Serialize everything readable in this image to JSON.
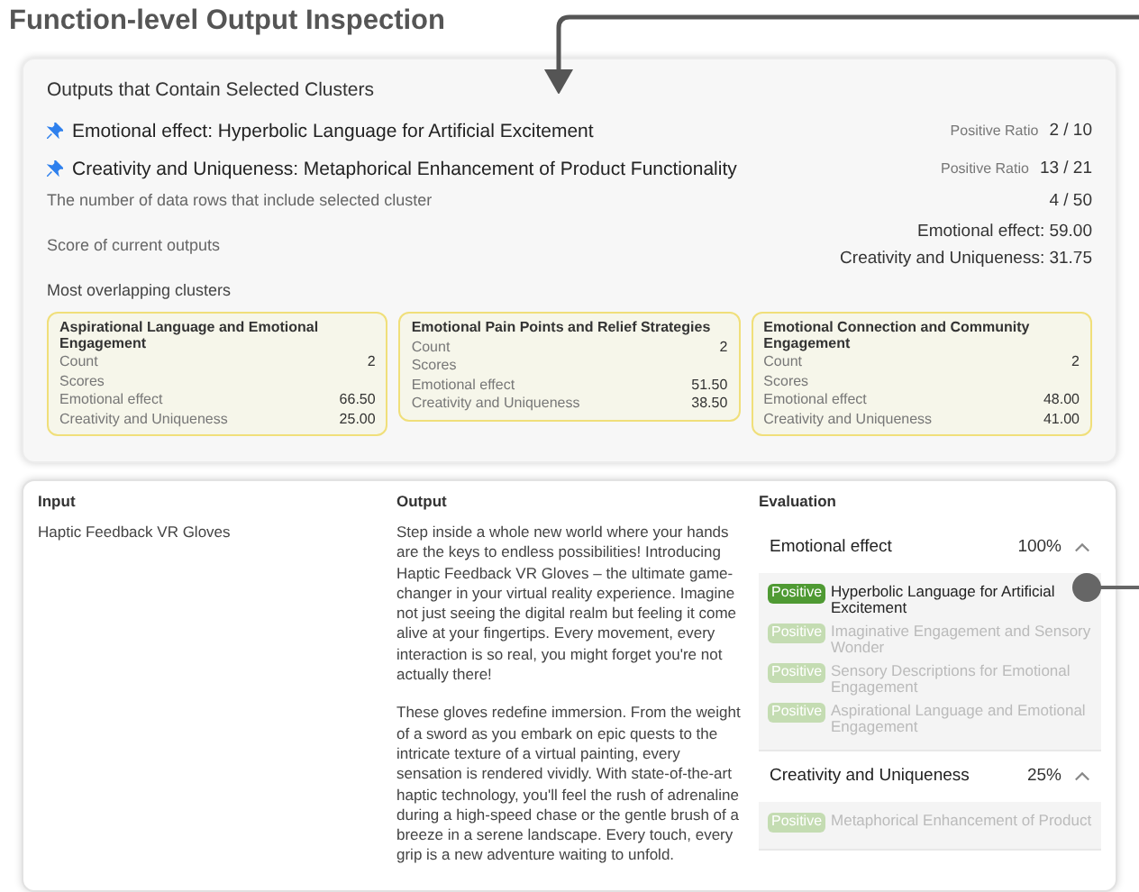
{
  "title": "Function-level Output Inspection",
  "summary": {
    "heading": "Outputs that Contain Selected Clusters",
    "selected_clusters": [
      {
        "text": "Emotional effect: Hyperbolic Language for Artificial Excitement",
        "ratio_label": "Positive Ratio",
        "ratio": "2 / 10"
      },
      {
        "text": "Creativity and Uniqueness: Metaphorical Enhancement of Product Functionality",
        "ratio_label": "Positive Ratio",
        "ratio": "13 / 21"
      }
    ],
    "rows_label": "The number of data rows that include selected cluster",
    "rows_value": "4 / 50",
    "score_label": "Score of current outputs",
    "scores": [
      "Emotional effect: 59.00",
      "Creativity and Uniqueness: 31.75"
    ],
    "overlap_label": "Most overlapping clusters",
    "overlap_clusters": [
      {
        "name": "Aspirational Language and Emotional Engagement",
        "count_label": "Count",
        "count": "2",
        "scores_label": "Scores",
        "scores": [
          {
            "name": "Emotional effect",
            "value": "66.50"
          },
          {
            "name": "Creativity and Uniqueness",
            "value": "25.00"
          }
        ]
      },
      {
        "name": "Emotional Pain Points and Relief Strategies",
        "count_label": "Count",
        "count": "2",
        "scores_label": "Scores",
        "scores": [
          {
            "name": "Emotional effect",
            "value": "51.50"
          },
          {
            "name": "Creativity and Uniqueness",
            "value": "38.50"
          }
        ]
      },
      {
        "name": "Emotional Connection and Community Engagement",
        "count_label": "Count",
        "count": "2",
        "scores_label": "Scores",
        "scores": [
          {
            "name": "Emotional effect",
            "value": "48.00"
          },
          {
            "name": "Creativity and Uniqueness",
            "value": "41.00"
          }
        ]
      }
    ]
  },
  "table": {
    "columns": [
      "Input",
      "Output",
      "Evaluation"
    ],
    "input": "Haptic Feedback VR Gloves",
    "output": [
      "Step inside a whole new world where your hands are the keys to endless possibilities! Introducing Haptic Feedback VR Gloves – the ultimate game-changer in your virtual reality experience. Imagine not just seeing the digital realm but feeling it come alive at your fingertips. Every movement, every interaction is so real, you might forget you're not actually there!",
      "These gloves redefine immersion. From the weight of a sword as you embark on epic quests to the intricate texture of a virtual painting, every sensation is rendered vividly. With state-of-the-art haptic technology, you'll feel the rush of adrenaline during a high-speed chase or the gentle brush of a breeze in a serene landscape. Every touch, every grip is a new adventure waiting to unfold."
    ],
    "evaluation": [
      {
        "name": "Emotional effect",
        "percent": "100%",
        "expanded": true,
        "clusters": [
          {
            "badge": "Positive",
            "text": "Hyperbolic Language for Artificial Excitement",
            "selected": true
          },
          {
            "badge": "Positive",
            "text": "Imaginative Engagement and Sensory Wonder",
            "selected": false
          },
          {
            "badge": "Positive",
            "text": "Sensory Descriptions for Emotional Engagement",
            "selected": false
          },
          {
            "badge": "Positive",
            "text": "Aspirational Language and Emotional Engagement",
            "selected": false
          }
        ]
      },
      {
        "name": "Creativity and Uniqueness",
        "percent": "25%",
        "expanded": true,
        "clusters": [
          {
            "badge": "Positive",
            "text": "Metaphorical Enhancement of Product",
            "selected": false
          }
        ]
      }
    ]
  }
}
